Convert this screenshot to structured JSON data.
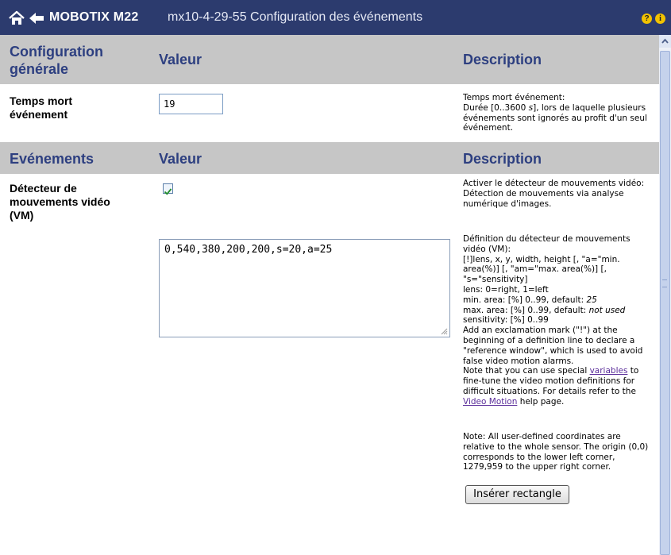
{
  "header": {
    "brand": "MOBOTIX M22",
    "subtitle": "mx10-4-29-55 Configuration des événements",
    "help_glyph": "?",
    "info_glyph": "i"
  },
  "general_section": {
    "col1": "Configuration générale",
    "col2": "Valeur",
    "col3": "Description"
  },
  "dead_time": {
    "label": "Temps mort événement",
    "value": "19",
    "desc_title": "Temps mort événement:",
    "desc_pre": "Durée [0..3600 ",
    "desc_unit": "s",
    "desc_post": "], lors de laquelle plusieurs événements sont ignorés au profit d'un seul événement."
  },
  "events_section": {
    "col1": "Evénements",
    "col2": "Valeur",
    "col3": "Description"
  },
  "vm": {
    "label": "Détecteur de mouvements vidéo (VM)",
    "checked": true,
    "desc1_title": "Activer le détecteur de mouvements vidéo:",
    "desc1_body": "Détection de mouvements via analyse numérique d'images.",
    "definition": "0,540,380,200,200,s=20,a=25",
    "def_title": "Définition du détecteur de mouvements vidéo (VM):",
    "def_syntax": "[!]lens, x, y, width, height [, \"a=\"min. area(%)] [, \"am=\"max. area(%)] [, \"s=\"sensitivity]",
    "def_lens": "lens: 0=right, 1=left",
    "def_min_pre": "min. area: [%] 0..99, default: ",
    "def_min_default": "25",
    "def_max_pre": "max. area: [%] 0..99, default: ",
    "def_max_default": "not used",
    "def_sens": "sensitivity: [%] 0..99",
    "def_excl": "Add an exclamation mark (\"!\") at the beginning of a definition line to declare a \"reference window\", which is used to avoid false video motion alarms.",
    "def_note_pre": "Note that you can use special ",
    "def_note_link": "variables",
    "def_note_mid": " to fine-tune the video motion definitions for difficult situations. For details refer to the ",
    "def_note_link2": "Video Motion",
    "def_note_post": " help page.",
    "coord_note": "Note: All user-defined coordinates are relative to the whole sensor. The origin (0,0) corresponds to the lower left corner, 1279,959 to the upper right corner.",
    "insert_button": "Insérer rectangle"
  },
  "colors": {
    "titlebar": "#2c3b6e",
    "header_band": "#c6c6c6",
    "header_text": "#2d3f80",
    "link": "#5a2d9a"
  }
}
